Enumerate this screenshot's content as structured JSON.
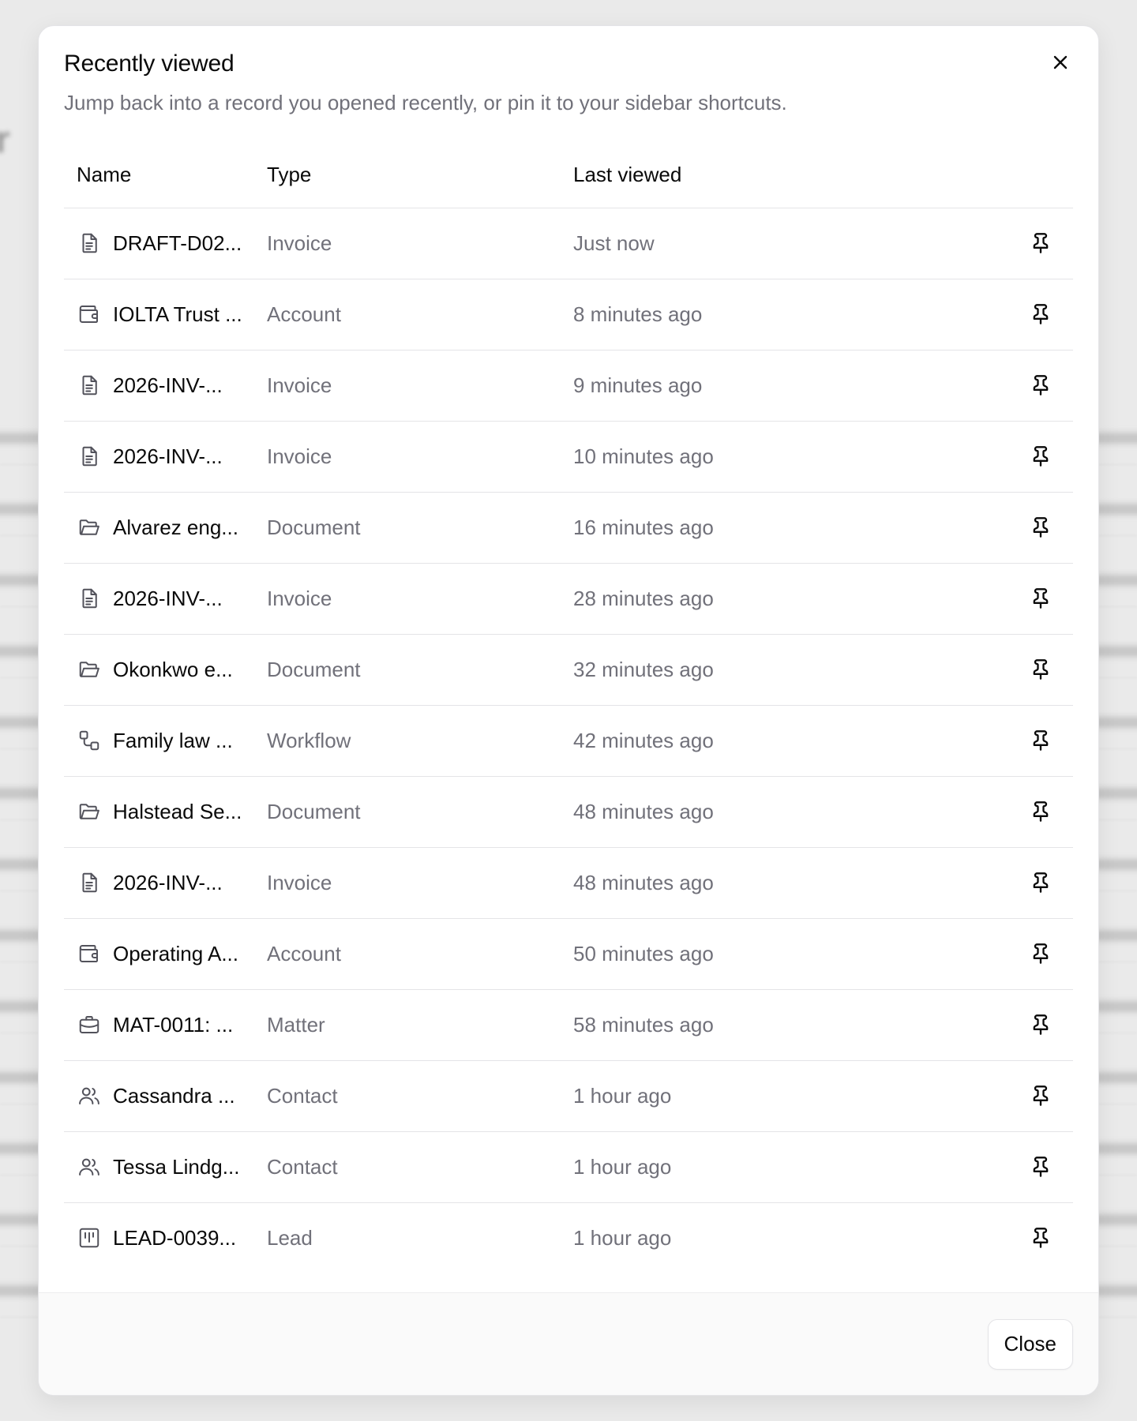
{
  "dialog": {
    "title": "Recently viewed",
    "description": "Jump back into a record you opened recently, or pin it to your sidebar shortcuts.",
    "close_label": "Close"
  },
  "table": {
    "headers": {
      "name": "Name",
      "type": "Type",
      "last_viewed": "Last viewed"
    },
    "rows": [
      {
        "icon": "invoice-icon",
        "name": "DRAFT-D02...",
        "type": "Invoice",
        "last_viewed": "Just now"
      },
      {
        "icon": "wallet-icon",
        "name": "IOLTA Trust ...",
        "type": "Account",
        "last_viewed": "8 minutes ago"
      },
      {
        "icon": "invoice-icon",
        "name": "2026-INV-...",
        "type": "Invoice",
        "last_viewed": "9 minutes ago"
      },
      {
        "icon": "invoice-icon",
        "name": "2026-INV-...",
        "type": "Invoice",
        "last_viewed": "10 minutes ago"
      },
      {
        "icon": "folder-icon",
        "name": "Alvarez eng...",
        "type": "Document",
        "last_viewed": "16 minutes ago"
      },
      {
        "icon": "invoice-icon",
        "name": "2026-INV-...",
        "type": "Invoice",
        "last_viewed": "28 minutes ago"
      },
      {
        "icon": "folder-icon",
        "name": "Okonkwo e...",
        "type": "Document",
        "last_viewed": "32 minutes ago"
      },
      {
        "icon": "workflow-icon",
        "name": "Family law ...",
        "type": "Workflow",
        "last_viewed": "42 minutes ago"
      },
      {
        "icon": "folder-icon",
        "name": "Halstead Se...",
        "type": "Document",
        "last_viewed": "48 minutes ago"
      },
      {
        "icon": "invoice-icon",
        "name": "2026-INV-...",
        "type": "Invoice",
        "last_viewed": "48 minutes ago"
      },
      {
        "icon": "wallet-icon",
        "name": "Operating A...",
        "type": "Account",
        "last_viewed": "50 minutes ago"
      },
      {
        "icon": "briefcase-icon",
        "name": "MAT-0011: ...",
        "type": "Matter",
        "last_viewed": "58 minutes ago"
      },
      {
        "icon": "contact-icon",
        "name": "Cassandra ...",
        "type": "Contact",
        "last_viewed": "1 hour ago"
      },
      {
        "icon": "contact-icon",
        "name": "Tessa Lindg...",
        "type": "Contact",
        "last_viewed": "1 hour ago"
      },
      {
        "icon": "kanban-icon",
        "name": "LEAD-0039...",
        "type": "Lead",
        "last_viewed": "1 hour ago"
      }
    ]
  }
}
